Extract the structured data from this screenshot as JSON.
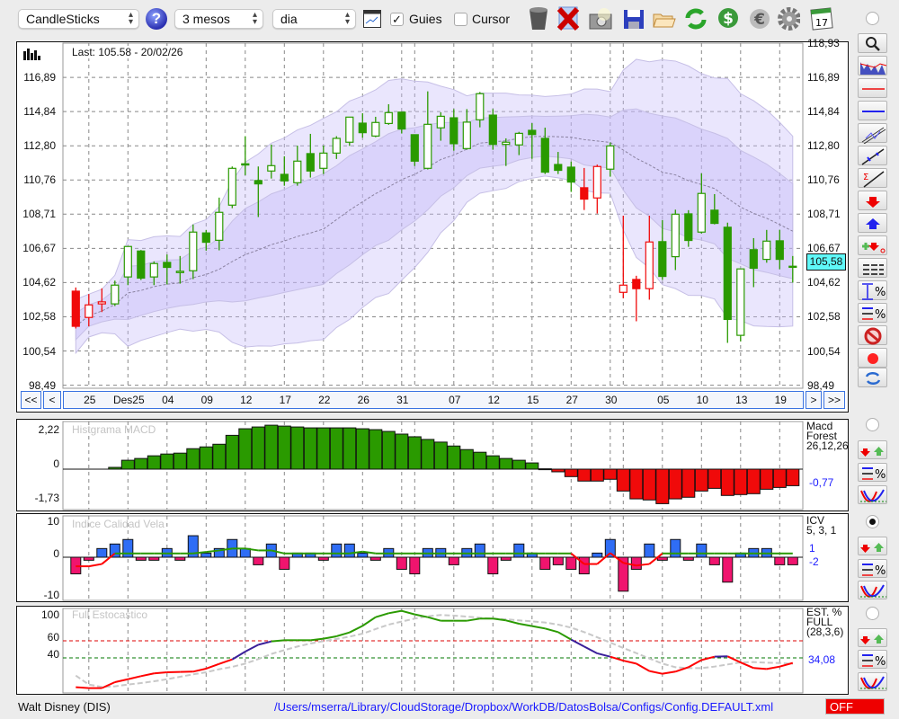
{
  "toolbar": {
    "chart_type": "CandleSticks",
    "period": "3 mesos",
    "interval": "dia",
    "guides_label": "Guies",
    "guides_checked": true,
    "cursor_label": "Cursor",
    "cursor_checked": false,
    "icons": [
      "help-icon",
      "chart-window-icon",
      "trash-icon",
      "delete-icon",
      "camera-icon",
      "save-icon",
      "folder-open-icon",
      "refresh-icon",
      "dollar-icon",
      "euro-icon",
      "gear-icon",
      "calendar-icon"
    ],
    "calendar_day": "17"
  },
  "main_chart": {
    "last_label": "Last: 105.58 - 20/02/26",
    "current_price_label": "105,58",
    "y_ticks": [
      "118,93",
      "116,89",
      "114,84",
      "112,80",
      "110,76",
      "108,71",
      "106,67",
      "104,62",
      "102,58",
      "100,54",
      "98,49"
    ],
    "nav": {
      "first": "<<",
      "prev": "<",
      "next": ">",
      "last": ">>"
    }
  },
  "chart_data": [
    {
      "type": "candlestick",
      "title": "Walt Disney (DIS)",
      "ylim": [
        98.49,
        118.93
      ],
      "x_gridlines": [
        {
          "index": 1,
          "label": "25"
        },
        {
          "index": 4,
          "label": "Des25"
        },
        {
          "index": 7,
          "label": "04"
        },
        {
          "index": 10,
          "label": "09"
        },
        {
          "index": 13,
          "label": "12"
        },
        {
          "index": 16,
          "label": "17"
        },
        {
          "index": 19,
          "label": "22"
        },
        {
          "index": 22,
          "label": "26"
        },
        {
          "index": 25,
          "label": "31"
        },
        {
          "index": 26,
          "label": ""
        },
        {
          "index": 29,
          "label": "07"
        },
        {
          "index": 32,
          "label": "12"
        },
        {
          "index": 35,
          "label": "15"
        },
        {
          "index": 38,
          "label": "27"
        },
        {
          "index": 41,
          "label": "30"
        },
        {
          "index": 42,
          "label": ""
        },
        {
          "index": 45,
          "label": "05"
        },
        {
          "index": 48,
          "label": "10"
        },
        {
          "index": 51,
          "label": "13"
        },
        {
          "index": 54,
          "label": "19"
        }
      ],
      "ohlc_fields": [
        "open",
        "high",
        "low",
        "close",
        "trend"
      ],
      "candles": [
        [
          104.11,
          104.33,
          101.88,
          102.01,
          "r"
        ],
        [
          102.54,
          103.94,
          102.01,
          103.29,
          "r"
        ],
        [
          103.35,
          104.28,
          102.86,
          103.47,
          "r"
        ],
        [
          103.35,
          104.74,
          103.22,
          104.47,
          "g"
        ],
        [
          104.96,
          106.78,
          104.47,
          106.78,
          "g"
        ],
        [
          106.51,
          106.57,
          104.78,
          104.89,
          "g"
        ],
        [
          104.96,
          105.89,
          104.47,
          105.76,
          "g"
        ],
        [
          105.83,
          106.3,
          104.51,
          105.53,
          "g"
        ],
        [
          105.22,
          106.21,
          104.56,
          105.3,
          "g"
        ],
        [
          105.33,
          108.09,
          104.83,
          107.64,
          "g"
        ],
        [
          107.59,
          107.77,
          106.53,
          107.03,
          "g"
        ],
        [
          107.15,
          109.7,
          106.55,
          108.82,
          "g"
        ],
        [
          109.25,
          111.56,
          109.07,
          111.45,
          "g"
        ],
        [
          111.72,
          113.37,
          111.04,
          111.65,
          "g"
        ],
        [
          110.72,
          111.56,
          108.54,
          110.52,
          "g"
        ],
        [
          111.29,
          112.87,
          110.84,
          111.61,
          "g"
        ],
        [
          111.09,
          112.17,
          110.41,
          110.7,
          "g"
        ],
        [
          110.59,
          112.81,
          110.41,
          111.88,
          "g"
        ],
        [
          112.33,
          113.51,
          110.9,
          111.29,
          "g"
        ],
        [
          111.45,
          112.81,
          111.11,
          112.36,
          "g"
        ],
        [
          112.36,
          113.37,
          112.01,
          113.24,
          "g"
        ],
        [
          113.01,
          114.51,
          112.79,
          114.51,
          "g"
        ],
        [
          114.15,
          114.74,
          113.28,
          113.58,
          "g"
        ],
        [
          113.38,
          114.53,
          113.31,
          114.19,
          "g"
        ],
        [
          114.13,
          115.28,
          114.05,
          114.78,
          "g"
        ],
        [
          114.81,
          114.81,
          113.53,
          113.8,
          "g"
        ],
        [
          113.46,
          113.46,
          111.59,
          111.88,
          "g"
        ],
        [
          111.45,
          116.05,
          111.38,
          114.08,
          "g"
        ],
        [
          113.87,
          114.8,
          113.1,
          114.56,
          "g"
        ],
        [
          114.47,
          114.99,
          112.5,
          112.92,
          "g"
        ],
        [
          112.63,
          114.99,
          112.56,
          114.21,
          "g"
        ],
        [
          114.35,
          116.01,
          113.9,
          115.91,
          "g"
        ],
        [
          114.63,
          114.99,
          112.56,
          112.88,
          "g"
        ],
        [
          112.88,
          113.24,
          111.59,
          113.01,
          "g"
        ],
        [
          112.85,
          113.63,
          112.24,
          113.54,
          "g"
        ],
        [
          113.72,
          114.15,
          112.02,
          113.47,
          "g"
        ],
        [
          113.24,
          113.88,
          111.11,
          111.22,
          "g"
        ],
        [
          111.68,
          112.43,
          111.11,
          111.33,
          "g"
        ],
        [
          111.52,
          111.85,
          110.04,
          110.63,
          "g"
        ],
        [
          110.29,
          111.47,
          108.96,
          109.61,
          "r"
        ],
        [
          109.68,
          111.67,
          108.75,
          111.56,
          "r"
        ],
        [
          111.4,
          112.99,
          110.95,
          112.79,
          "g"
        ],
        [
          104.04,
          108.62,
          103.69,
          104.47,
          "r"
        ],
        [
          104.81,
          105.03,
          102.31,
          104.26,
          "r"
        ],
        [
          104.26,
          108.62,
          103.6,
          107.05,
          "r"
        ],
        [
          107.07,
          108.36,
          104.78,
          104.99,
          "g"
        ],
        [
          106.17,
          108.98,
          105.37,
          108.71,
          "g"
        ],
        [
          108.73,
          108.95,
          106.76,
          107.14,
          "g"
        ],
        [
          107.64,
          111.15,
          107.55,
          109.95,
          "g"
        ],
        [
          108.95,
          109.91,
          108.1,
          108.16,
          "g"
        ],
        [
          107.93,
          108.2,
          101.02,
          102.42,
          "g"
        ],
        [
          101.47,
          105.44,
          101.11,
          105.44,
          "g"
        ],
        [
          106.59,
          107.28,
          104.35,
          105.48,
          "g"
        ],
        [
          106.01,
          107.77,
          105.81,
          107.1,
          "g"
        ],
        [
          107.12,
          107.78,
          105.42,
          106.01,
          "g"
        ],
        [
          105.6,
          106.21,
          104.62,
          105.58,
          "g"
        ]
      ],
      "bollinger": {
        "period": 20,
        "inner_sigma": 1,
        "outer_sigma": 2
      }
    },
    {
      "type": "bar",
      "title": "Histgrama MACD",
      "side_labels": [
        "Macd",
        "Forest",
        "26,12,26"
      ],
      "readout": "-0,77",
      "y_ticks": [
        "2,22",
        "0",
        "-1,73"
      ],
      "ylim": [
        -1.73,
        2.22
      ],
      "values": [
        null,
        null,
        null,
        0.1,
        0.5,
        0.6,
        0.75,
        0.85,
        0.9,
        1.15,
        1.25,
        1.4,
        1.9,
        2.27,
        2.37,
        2.47,
        2.42,
        2.37,
        2.32,
        2.32,
        2.32,
        2.32,
        2.27,
        2.22,
        2.12,
        1.97,
        1.82,
        1.67,
        1.52,
        1.3,
        1.1,
        0.95,
        0.75,
        0.6,
        0.5,
        0.35,
        0.02,
        -0.15,
        -0.42,
        -0.67,
        -0.67,
        -0.57,
        -1.23,
        -1.67,
        -1.73,
        -1.94,
        -1.67,
        -1.58,
        -1.23,
        -1.08,
        -1.48,
        -1.43,
        -1.38,
        -1.13,
        -1.03,
        -0.93
      ]
    },
    {
      "type": "bar",
      "title": "Indice Calidad Vela",
      "side_labels": [
        "ICV",
        "5, 3, 1"
      ],
      "readouts": [
        "1",
        "-2"
      ],
      "y_ticks": [
        "10",
        "0",
        "-10"
      ],
      "ylim": [
        -10,
        10
      ],
      "values": [
        -4.4,
        -0.8,
        2.3,
        3.5,
        4.7,
        -0.8,
        -0.8,
        2.3,
        -0.8,
        5.7,
        1.1,
        2.3,
        4.7,
        2.3,
        -2,
        3.5,
        -3.2,
        1.1,
        1.1,
        -0.8,
        3.5,
        3.5,
        1.1,
        -0.8,
        2.3,
        -3.2,
        -4.4,
        2.3,
        2.3,
        -2,
        2.3,
        3.5,
        -4.4,
        -0.8,
        3.5,
        1.1,
        -3.2,
        -2,
        -3.2,
        -4.4,
        1.1,
        4.7,
        -9,
        -3.2,
        3.5,
        -0.8,
        4.7,
        -0.8,
        3.5,
        -2,
        -6.6,
        1.1,
        2.3,
        2.3,
        -2,
        -2
      ],
      "signal": [
        -2.4,
        -2.4,
        -1.8,
        1,
        1,
        1,
        1,
        1,
        1,
        1,
        1.4,
        1.8,
        2.3,
        2.3,
        1.8,
        1.8,
        1,
        1,
        1,
        1,
        1,
        1,
        1.5,
        1,
        1,
        1,
        1,
        1,
        1,
        1,
        1,
        1,
        1,
        1,
        1,
        1,
        1,
        1,
        1,
        -1.8,
        -1.8,
        1.1,
        -1.5,
        -2.2,
        -1.8,
        1,
        1,
        1,
        1,
        1,
        1,
        1,
        1,
        1,
        1,
        1
      ]
    },
    {
      "type": "line",
      "title": "Full Estocastico",
      "side_labels": [
        "EST. %",
        "FULL",
        "(28,3,6)"
      ],
      "readout": "34,08",
      "y_ticks": [
        "100",
        "60",
        "40"
      ],
      "ylim": [
        0,
        100
      ],
      "levels": [
        60,
        40
      ],
      "series": [
        {
          "name": "%K",
          "values": [
            5.6,
            4.6,
            4.6,
            11.6,
            15,
            18.6,
            21.8,
            23.2,
            23.5,
            23.9,
            27.4,
            33,
            38.2,
            47.4,
            55.4,
            59.3,
            60.7,
            60.7,
            60.7,
            62.5,
            65.3,
            69.8,
            77.5,
            87.7,
            92.3,
            95.1,
            90.9,
            87.7,
            83.5,
            83.5,
            83.5,
            86,
            86,
            83.9,
            80,
            77.2,
            74.4,
            70.2,
            61.4,
            53.3,
            45.3,
            41.4,
            36.8,
            33.3,
            24.6,
            21.4,
            23.9,
            29.1,
            37.5,
            41.4,
            41.8,
            34.7,
            28.1,
            27,
            29.8,
            34.08
          ]
        },
        {
          "name": "%D",
          "values": [
            19.3,
            8.8,
            6,
            6.7,
            8.8,
            10.5,
            12.6,
            15,
            17.9,
            20.7,
            23.2,
            26.7,
            29.5,
            33.3,
            38.6,
            44.6,
            49.1,
            53.3,
            56.8,
            59.6,
            62.1,
            64.9,
            68.4,
            73.7,
            79,
            82.5,
            86,
            88.8,
            90.2,
            89.5,
            88.4,
            87,
            86,
            85.3,
            83.9,
            82.8,
            81.4,
            79,
            75.4,
            70.2,
            64.2,
            57.9,
            51.6,
            45.6,
            39.3,
            33.3,
            29.1,
            28,
            28,
            29.8,
            32.3,
            34.7,
            35.1,
            34.4,
            34,
            33
          ]
        }
      ]
    }
  ],
  "colors": {
    "up": "#2a9a00",
    "down": "#f00a0a",
    "icv_pos": "#2f6df5",
    "icv_neg": "#f0146e",
    "stoch_mid": "#3a1f9a",
    "band": "#c9c0f5",
    "nav_border": "#3b73e0",
    "price_tag": "#5ff8f8"
  },
  "right_tools": [
    "zoom-icon",
    "chart-overlay-icon",
    "red-line-icon",
    "blue-line-icon",
    "channel-icon",
    "trendline-icon",
    "sigma-trendline-icon",
    "sell-arrow-icon",
    "buy-arrow-icon",
    "add-order-icon",
    "lines-icon",
    "range-percent-icon",
    "levels-percent-icon",
    "forbidden-icon",
    "record-icon",
    "sync-icon"
  ],
  "status": {
    "symbol": "Walt Disney (DIS)",
    "config_path": "/Users/mserra/Library/CloudStorage/Dropbox/WorkDB/DatosBolsa/Configs/Config.DEFAULT.xml",
    "mode": "OFF"
  }
}
